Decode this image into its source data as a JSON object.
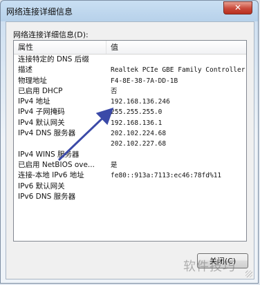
{
  "window": {
    "title": "网络连接详细信息"
  },
  "titlebar": {
    "close_glyph": "✕"
  },
  "section_label": "网络连接详细信息(D):",
  "table": {
    "headers": [
      "属性",
      "值"
    ],
    "rows": [
      {
        "prop": "连接特定的 DNS 后缀",
        "val": ""
      },
      {
        "prop": "描述",
        "val": "Realtek PCIe GBE Family Controller"
      },
      {
        "prop": "物理地址",
        "val": "F4-8E-38-7A-DD-1B"
      },
      {
        "prop": "已启用 DHCP",
        "val": "否"
      },
      {
        "prop": "IPv4 地址",
        "val": "192.168.136.246"
      },
      {
        "prop": "IPv4 子网掩码",
        "val": "255.255.255.0"
      },
      {
        "prop": "IPv4 默认网关",
        "val": "192.168.136.1"
      },
      {
        "prop": "IPv4 DNS 服务器",
        "val": "202.102.224.68"
      },
      {
        "prop": "",
        "val": "202.102.227.68"
      },
      {
        "prop": "IPv4 WINS 服务器",
        "val": ""
      },
      {
        "prop": "已启用 NetBIOS ove...",
        "val": "是"
      },
      {
        "prop": "连接-本地 IPv6 地址",
        "val": "fe80::913a:7113:ec46:78fd%11"
      },
      {
        "prop": "IPv6 默认网关",
        "val": ""
      },
      {
        "prop": "IPv6 DNS 服务器",
        "val": ""
      }
    ]
  },
  "footer": {
    "close_label": "关闭(C)"
  },
  "watermark": "软件技巧",
  "colors": {
    "arrow": "#3b4aa8",
    "close_red": "#c9493a"
  }
}
